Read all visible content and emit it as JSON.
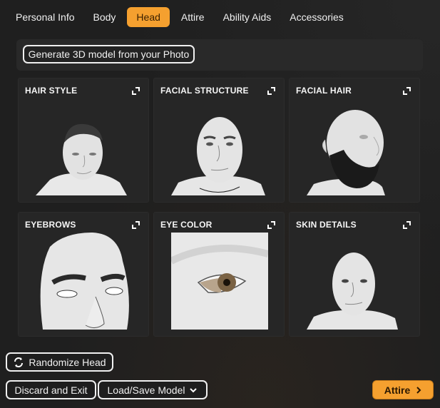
{
  "tabs": [
    {
      "label": "Personal Info",
      "active": false
    },
    {
      "label": "Body",
      "active": false
    },
    {
      "label": "Head",
      "active": true
    },
    {
      "label": "Attire",
      "active": false
    },
    {
      "label": "Ability Aids",
      "active": false
    },
    {
      "label": "Accessories",
      "active": false
    }
  ],
  "generate_button": "Generate 3D model from your Photo",
  "cards": [
    {
      "title": "HAIR STYLE",
      "icon": "expand-icon",
      "image": "head-with-short-hair"
    },
    {
      "title": "FACIAL STRUCTURE",
      "icon": "expand-icon",
      "image": "bald-head-front"
    },
    {
      "title": "FACIAL HAIR",
      "icon": "expand-icon",
      "image": "head-with-beard"
    },
    {
      "title": "EYEBROWS",
      "icon": "expand-icon",
      "image": "eyebrows-closeup"
    },
    {
      "title": "EYE COLOR",
      "icon": "expand-icon",
      "image": "eye-closeup-brown"
    },
    {
      "title": "SKIN DETAILS",
      "icon": "expand-icon",
      "image": "head-skin-front"
    }
  ],
  "footer": {
    "randomize_label": "Randomize Head",
    "discard_label": "Discard and Exit",
    "load_save_label": "Load/Save Model",
    "next_label": "Attire"
  },
  "colors": {
    "accent": "#f5a02f",
    "background": "#1e1e1e",
    "card": "#262626",
    "iris": "#7a6244"
  }
}
